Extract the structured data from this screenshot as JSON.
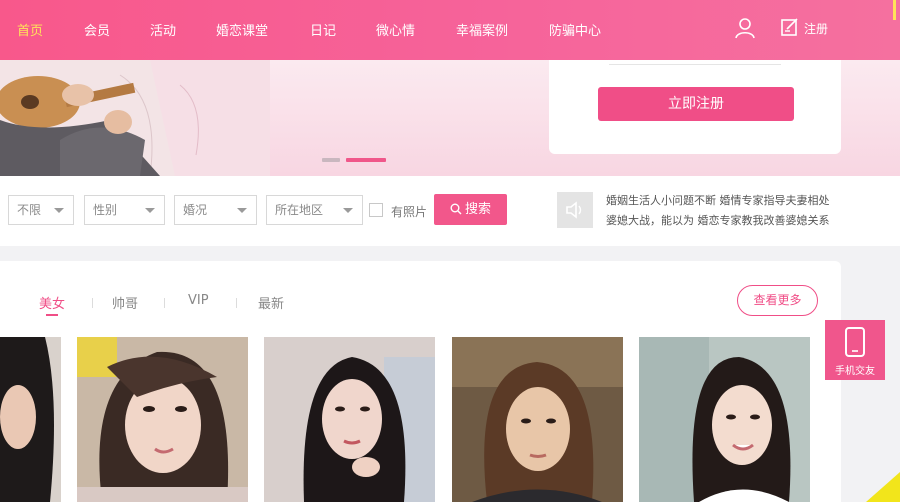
{
  "nav": {
    "items": [
      {
        "label": "首页",
        "active": true
      },
      {
        "label": "会员"
      },
      {
        "label": "活动"
      },
      {
        "label": "婚恋课堂"
      },
      {
        "label": "日记"
      },
      {
        "label": "微心情"
      },
      {
        "label": "幸福案例"
      },
      {
        "label": "防骗中心"
      }
    ],
    "register_label": "注册",
    "icons": [
      "user-icon",
      "register-icon"
    ]
  },
  "banner": {
    "register_button": "立即注册"
  },
  "filters": {
    "selects": [
      {
        "value": "不限"
      },
      {
        "value": "性别"
      },
      {
        "value": "婚况"
      },
      {
        "value": "所在地区"
      }
    ],
    "has_photo_label": "有照片",
    "search_label": "搜索",
    "notice_line1": "婚姻生活人小问题不断 婚情专家指导夫妻相处",
    "notice_line2": "婆媳大战，能以为 婚恋专家教我改善婆媳关系"
  },
  "members": {
    "tabs": [
      "美女",
      "帅哥",
      "VIP",
      "最新"
    ],
    "active_tab": "美女",
    "more_label": "查看更多"
  },
  "float": {
    "app_label": "手机交友"
  },
  "colors": {
    "brand": "#f04e87",
    "nav_active": "#ffe35a"
  }
}
